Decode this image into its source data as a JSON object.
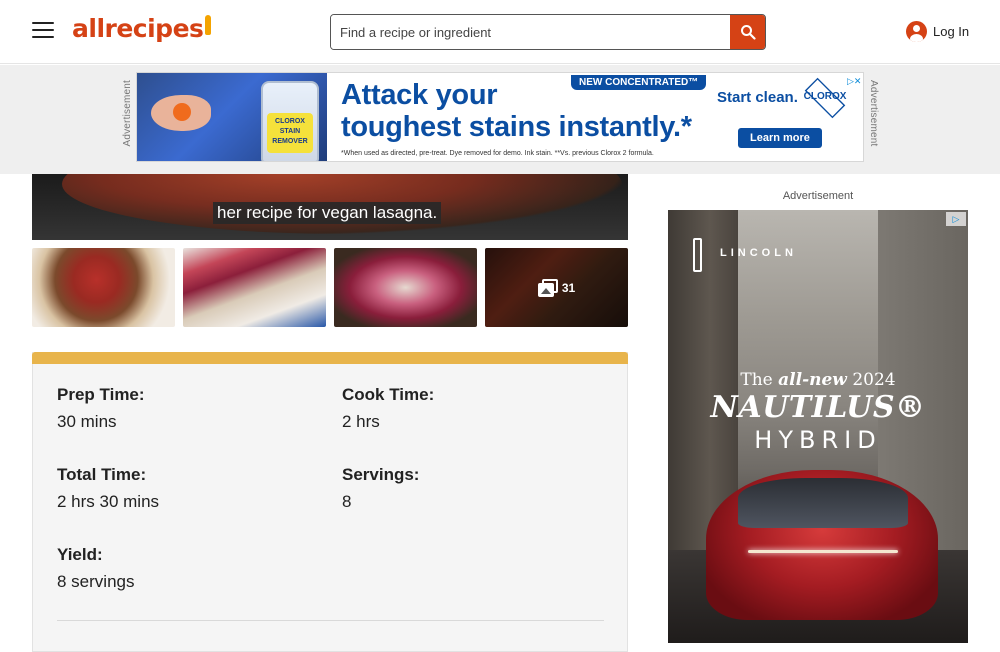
{
  "header": {
    "logo_text": "allrecipes",
    "search_placeholder": "Find a recipe or ingredient",
    "login_label": "Log In"
  },
  "top_ad": {
    "label": "Advertisement",
    "chip": "NEW CONCENTRATED™",
    "headline_line1": "Attack your",
    "headline_line2": "toughest stains instantly.*",
    "fine_print": "*When used as directed, pre-treat. Dye removed for demo. Ink stain. **Vs. previous Clorox 2 formula.",
    "start_clean": "Start clean.",
    "brand": "CLOROX",
    "bottle_text": "CLOROX STAIN REMOVER",
    "cta": "Learn more"
  },
  "video": {
    "caption": "her recipe for vegan lasagna."
  },
  "gallery": {
    "photo_count": "31"
  },
  "details": {
    "items": [
      {
        "label": "Prep Time:",
        "value": "30 mins"
      },
      {
        "label": "Cook Time:",
        "value": "2 hrs"
      },
      {
        "label": "Total Time:",
        "value": "2 hrs 30 mins"
      },
      {
        "label": "Servings:",
        "value": "8"
      },
      {
        "label": "Yield:",
        "value": "8 servings"
      }
    ]
  },
  "side_ad": {
    "label": "Advertisement",
    "brand": "LINCOLN",
    "line1_pre": "The ",
    "line1_em": "all-new",
    "line1_post": " 2024",
    "line2": "NAUTILUS®",
    "line3": "HYBRID"
  },
  "colors": {
    "brand": "#d54215",
    "details_accent": "#e8b44b",
    "ad_blue": "#0b4ea2"
  }
}
